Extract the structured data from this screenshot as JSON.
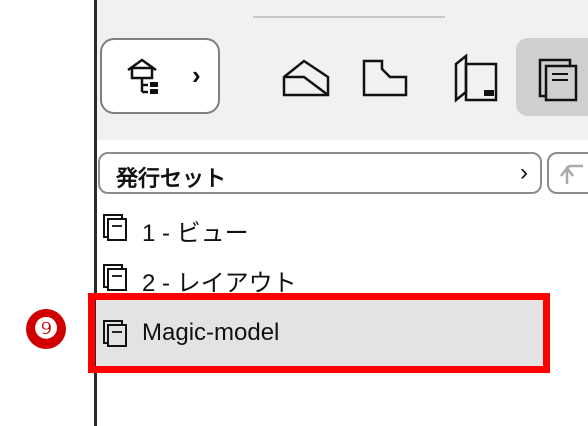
{
  "toolbar": {
    "navigator_icon": "navigator-tree-icon",
    "navigator_chevron": "›",
    "tools": [
      {
        "icon": "project-map-icon"
      },
      {
        "icon": "view-map-icon"
      },
      {
        "icon": "layout-book-icon"
      },
      {
        "icon": "publisher-sets-icon",
        "active": true
      }
    ],
    "accent_colors": {
      "selection_highlight": "#e3e3e3",
      "annotation_red": "#ff0000"
    }
  },
  "dropdown": {
    "label": "発行セット",
    "chevron": "›"
  },
  "list": {
    "items": [
      {
        "label": "1 - ビュー"
      },
      {
        "label": "2 - レイアウト"
      },
      {
        "label": "Magic-model",
        "selected": true
      }
    ]
  },
  "annotation": {
    "badge": "❾"
  }
}
